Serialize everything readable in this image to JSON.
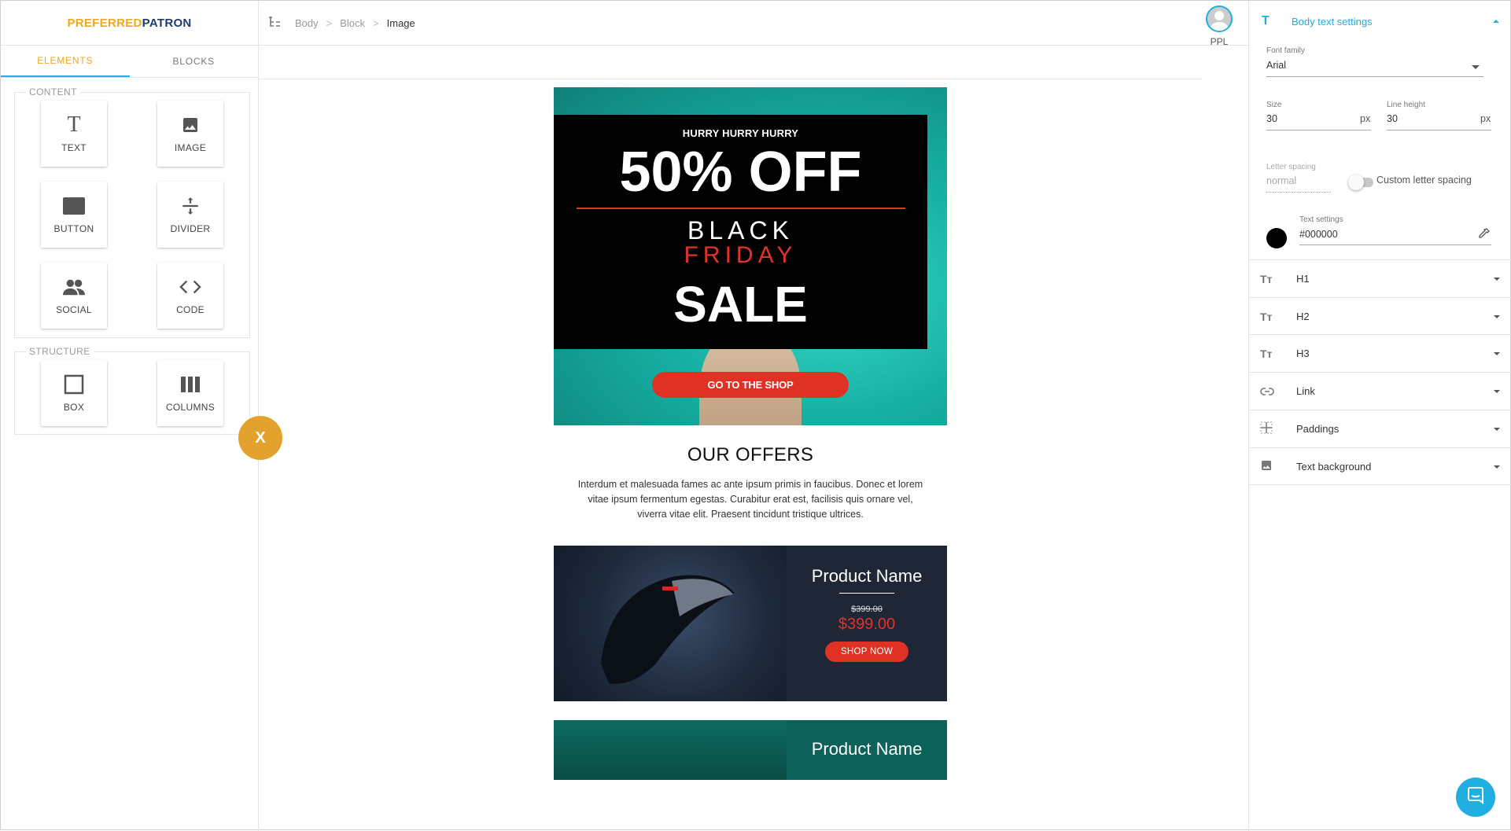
{
  "logo": {
    "part1": "PREFERRED",
    "part2": "PATRON"
  },
  "tabs": [
    {
      "label": "ELEMENTS"
    },
    {
      "label": "BLOCKS"
    }
  ],
  "content_group": {
    "label": "CONTENT",
    "tiles": [
      {
        "label": "TEXT",
        "icon": "text-icon"
      },
      {
        "label": "IMAGE",
        "icon": "image-icon"
      },
      {
        "label": "BUTTON",
        "icon": "button-icon"
      },
      {
        "label": "DIVIDER",
        "icon": "divider-icon"
      },
      {
        "label": "SOCIAL",
        "icon": "social-icon"
      },
      {
        "label": "CODE",
        "icon": "code-icon"
      }
    ]
  },
  "structure_group": {
    "label": "STRUCTURE",
    "tiles": [
      {
        "label": "BOX",
        "icon": "box-icon"
      },
      {
        "label": "COLUMNS",
        "icon": "columns-icon"
      }
    ]
  },
  "close_fab": {
    "label": "X"
  },
  "breadcrumb": {
    "items": [
      "Body",
      "Block"
    ],
    "current": "Image",
    "separator": ">"
  },
  "user": {
    "label": "PPL"
  },
  "email": {
    "hero": {
      "kicker": "HURRY HURRY HURRY",
      "headline": "50% OFF",
      "line1": "BLACK",
      "line2": "FRIDAY",
      "line3": "SALE",
      "cta": "GO TO THE SHOP"
    },
    "offers": {
      "title": "OUR OFFERS",
      "text": "Interdum et malesuada fames ac ante ipsum primis in faucibus. Donec et lorem vitae ipsum fermentum egestas. Curabitur erat est, facilisis quis ornare vel, viverra vitae elit. Praesent tincidunt tristique ultrices."
    },
    "product1": {
      "name": "Product Name",
      "old_price": "$399.00",
      "price": "$399.00",
      "cta": "SHOP NOW"
    },
    "product2": {
      "name": "Product Name"
    }
  },
  "settings": {
    "header": "Body text settings",
    "font_family": {
      "label": "Font family",
      "value": "Arial"
    },
    "size": {
      "label": "Size",
      "value": "30",
      "unit": "px"
    },
    "line_height": {
      "label": "Line height",
      "value": "30",
      "unit": "px"
    },
    "letter_spacing": {
      "label": "Letter spacing",
      "value": "normal"
    },
    "custom_letter_spacing": {
      "label": "Custom letter spacing",
      "enabled": false
    },
    "text_color": {
      "label": "Text settings",
      "value": "#000000"
    },
    "sections": [
      {
        "label": "H1",
        "icon": "heading-icon"
      },
      {
        "label": "H2",
        "icon": "heading-icon"
      },
      {
        "label": "H3",
        "icon": "heading-icon"
      },
      {
        "label": "Link",
        "icon": "link-icon"
      },
      {
        "label": "Paddings",
        "icon": "padding-icon"
      },
      {
        "label": "Text background",
        "icon": "image-icon"
      }
    ]
  },
  "colors": {
    "accent": "#21aee0",
    "brand_orange": "#f0a81c",
    "cta_red": "#e03224"
  }
}
